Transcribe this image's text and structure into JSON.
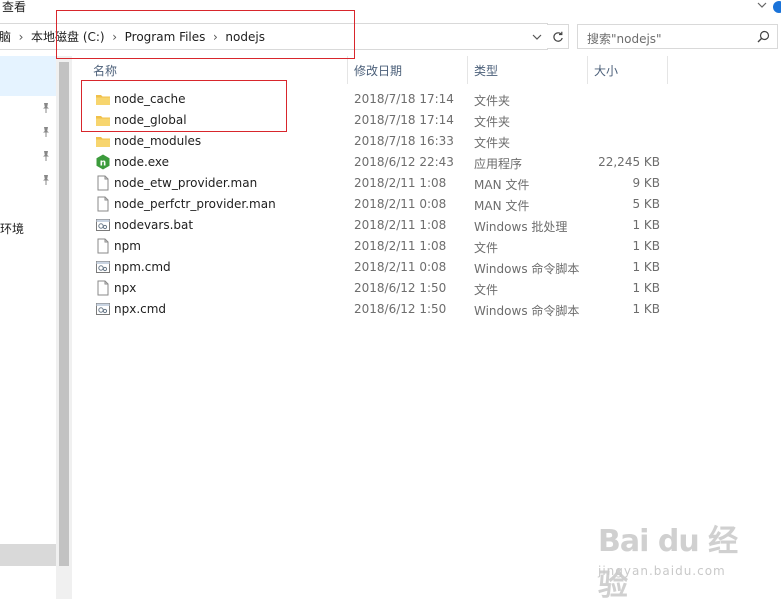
{
  "menu": {
    "view_label": "查看"
  },
  "address": {
    "crumbs": [
      "脑",
      "本地磁盘 (C:)",
      "Program Files",
      "nodejs"
    ]
  },
  "search": {
    "placeholder": "搜索\"nodejs\""
  },
  "nav": {
    "label": "环境"
  },
  "columns": {
    "name": "名称",
    "modified": "修改日期",
    "type": "类型",
    "size": "大小"
  },
  "files": [
    {
      "name": "node_cache",
      "modified": "2018/7/18 17:14",
      "type": "文件夹",
      "size": "",
      "icon": "folder-icon"
    },
    {
      "name": "node_global",
      "modified": "2018/7/18 17:14",
      "type": "文件夹",
      "size": "",
      "icon": "folder-icon"
    },
    {
      "name": "node_modules",
      "modified": "2018/7/18 16:33",
      "type": "文件夹",
      "size": "",
      "icon": "folder-icon"
    },
    {
      "name": "node.exe",
      "modified": "2018/6/12 22:43",
      "type": "应用程序",
      "size": "22,245 KB",
      "icon": "nodejs-exe-icon"
    },
    {
      "name": "node_etw_provider.man",
      "modified": "2018/2/11 1:08",
      "type": "MAN 文件",
      "size": "9 KB",
      "icon": "file-icon"
    },
    {
      "name": "node_perfctr_provider.man",
      "modified": "2018/2/11 0:08",
      "type": "MAN 文件",
      "size": "5 KB",
      "icon": "file-icon"
    },
    {
      "name": "nodevars.bat",
      "modified": "2018/2/11 1:08",
      "type": "Windows 批处理",
      "size": "1 KB",
      "icon": "script-icon"
    },
    {
      "name": "npm",
      "modified": "2018/2/11 1:08",
      "type": "文件",
      "size": "1 KB",
      "icon": "file-icon"
    },
    {
      "name": "npm.cmd",
      "modified": "2018/2/11 0:08",
      "type": "Windows 命令脚本",
      "size": "1 KB",
      "icon": "script-icon"
    },
    {
      "name": "npx",
      "modified": "2018/6/12 1:50",
      "type": "文件",
      "size": "1 KB",
      "icon": "file-icon"
    },
    {
      "name": "npx.cmd",
      "modified": "2018/6/12 1:50",
      "type": "Windows 命令脚本",
      "size": "1 KB",
      "icon": "script-icon"
    }
  ],
  "watermark": {
    "logo_text": "Bai du 经验",
    "url_text": "jingyan.baidu.com"
  },
  "colors": {
    "highlight": "#d8262c",
    "folder": "#f0c04a",
    "node_green": "#3c9b3c",
    "header_text": "#4c607a"
  }
}
